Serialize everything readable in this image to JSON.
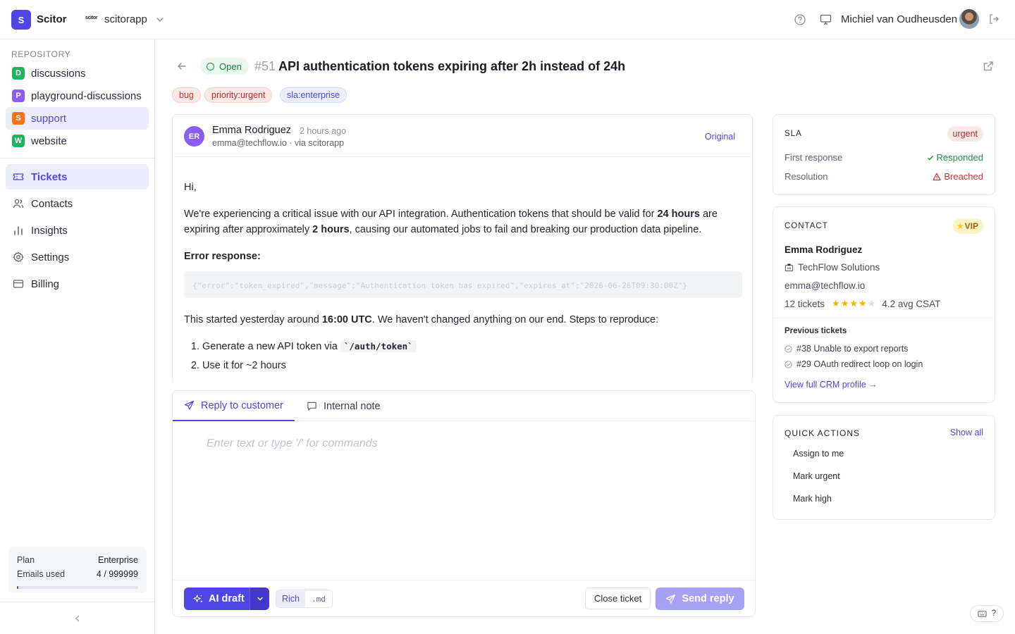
{
  "app": {
    "logo_letter": "S",
    "name": "Scitor",
    "org_logo_text": "scitor",
    "org_name": "scitorapp"
  },
  "user": {
    "name": "Michiel van Oudheusden"
  },
  "sidebar": {
    "repository_label": "REPOSITORY",
    "repos": [
      {
        "letter": "D",
        "label": "discussions",
        "color": "#22b35e"
      },
      {
        "letter": "P",
        "label": "playground-discussions",
        "color": "#8b5cf6"
      },
      {
        "letter": "S",
        "label": "support",
        "color": "#f97316"
      },
      {
        "letter": "W",
        "label": "website",
        "color": "#22b35e"
      }
    ],
    "nav": [
      {
        "label": "Tickets",
        "icon": "ticket-icon"
      },
      {
        "label": "Contacts",
        "icon": "users-icon"
      },
      {
        "label": "Insights",
        "icon": "bar-chart-icon"
      },
      {
        "label": "Settings",
        "icon": "gear-icon"
      },
      {
        "label": "Billing",
        "icon": "credit-card-icon"
      }
    ],
    "plan": {
      "plan_label": "Plan",
      "plan_value": "Enterprise",
      "emails_label": "Emails used",
      "emails_value": "4 / 999999",
      "usage_fraction": 0.01
    }
  },
  "ticket": {
    "status": "Open",
    "number": "#51",
    "title": "API authentication tokens expiring after 2h instead of 24h",
    "tags": [
      "bug",
      "priority:urgent",
      "sla:enterprise"
    ]
  },
  "message": {
    "avatar_initials": "ER",
    "author": "Emma Rodriguez",
    "time": "2 hours ago",
    "meta": "emma@techflow.io · via scitorapp",
    "original_label": "Original",
    "greeting": "Hi,",
    "p1_a": "We're experiencing a critical issue with our API integration. Authentication tokens that should be valid for ",
    "p1_b": "24 hours",
    "p1_c": " are expiring after approximately ",
    "p1_d": "2 hours",
    "p1_e": ", causing our automated jobs to fail and breaking our production data pipeline.",
    "error_heading": "Error response:",
    "code": "{\"error\":\"token_expired\",\"message\":\"Authentication token has expired\",\"expires_at\":\"2026-06-26T09:30:00Z\"}",
    "p2_a": "This started yesterday around ",
    "p2_b": "16:00 UTC",
    "p2_c": ". We haven't changed anything on our end. Steps to reproduce:",
    "step1_a": "Generate a new API token via ",
    "step1_code": "`/auth/token`",
    "step2": "Use it for ~2 hours"
  },
  "reply": {
    "tab_customer": "Reply to customer",
    "tab_internal": "Internal note",
    "placeholder": "Enter text or type '/' for commands",
    "ai_draft": "AI draft",
    "fmt_rich": "Rich",
    "fmt_md": ".md",
    "close_ticket": "Close ticket",
    "send_reply": "Send reply"
  },
  "sla": {
    "title": "SLA",
    "badge": "urgent",
    "first_response_label": "First response",
    "first_response_value": "Responded",
    "resolution_label": "Resolution",
    "resolution_value": "Breached"
  },
  "contact": {
    "title": "CONTACT",
    "vip": "VIP",
    "name": "Emma Rodriguez",
    "company": "TechFlow Solutions",
    "email": "emma@techflow.io",
    "tickets": "12 tickets",
    "rating_stars": 4,
    "csat": "4.2 avg CSAT",
    "previous_title": "Previous tickets",
    "previous": [
      "#38 Unable to export reports",
      "#29 OAuth redirect loop on login"
    ],
    "crm_link": "View full CRM profile →"
  },
  "quick_actions": {
    "title": "QUICK ACTIONS",
    "show_all": "Show all",
    "items": [
      "Assign to me",
      "Mark urgent",
      "Mark high"
    ]
  },
  "help_button": {
    "label": "?"
  },
  "colors": {
    "accent": "#4f46e5",
    "success": "#1a8f43",
    "danger": "#c0392b"
  }
}
